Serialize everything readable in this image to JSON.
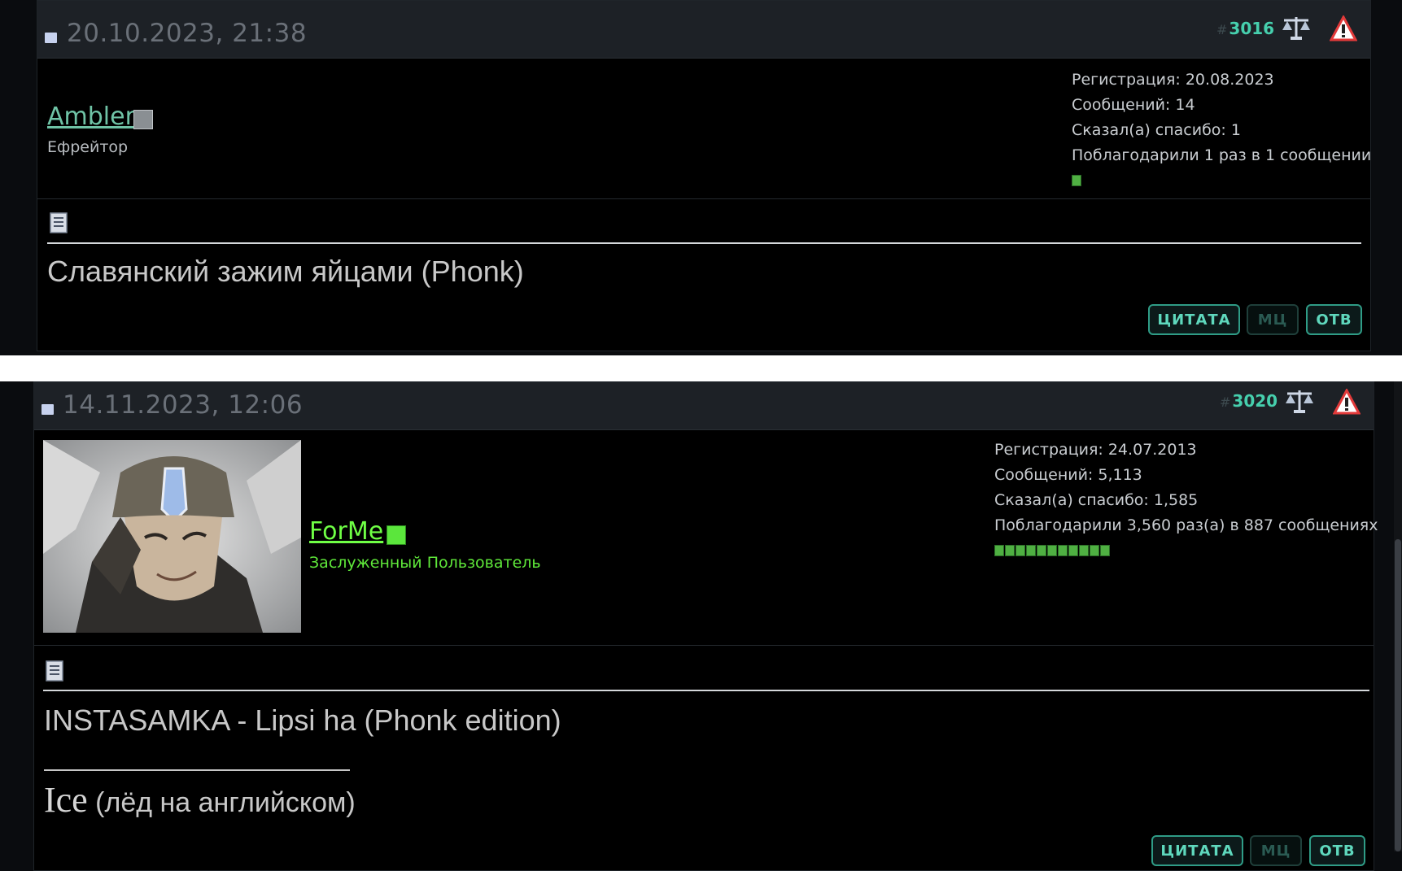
{
  "posts": [
    {
      "date": "20.10.2023, 21:38",
      "number_hash": "#",
      "number": "3016",
      "username": "Ambler",
      "user_title": "Ефрейтор",
      "stats": {
        "registration": "Регистрация: 20.08.2023",
        "messages": "Сообщений: 14",
        "said_thanks": "Сказал(а) спасибо: 1",
        "thanked": "Поблагодарили 1 раз в 1 сообщении"
      },
      "reputation_segments": 1,
      "body_line1": "Славянский зажим яйцами (Phonk)",
      "buttons": {
        "quote": "ЦИТАТА",
        "multiquote": "МЦ",
        "reply": "ОТВ"
      }
    },
    {
      "date": "14.11.2023, 12:06",
      "number_hash": "#",
      "number": "3020",
      "username": "ForMe",
      "user_title": "Заслуженный Пользователь",
      "stats": {
        "registration": "Регистрация: 24.07.2013",
        "messages": "Сообщений: 5,113",
        "said_thanks": "Сказал(а) спасибо: 1,585",
        "thanked": "Поблагодарили 3,560 раз(а) в 887 сообщениях"
      },
      "reputation_segments": 11,
      "body_line1": "INSTASAMKA - Lipsi ha (Phonk edition)",
      "signature_big": "Ice",
      "signature_small": " (лёд на английском)",
      "buttons": {
        "quote": "ЦИТАТА",
        "multiquote": "МЦ",
        "reply": "ОТВ"
      }
    }
  ],
  "icons": {
    "post_dot": "post-icon",
    "scale": "balance-scale-icon",
    "warning": "warning-icon",
    "document": "document-icon",
    "online": "online-status-icon",
    "avatar": "user-avatar"
  },
  "colors": {
    "accent_teal": "#46cfad",
    "username_1": "#6fc3a6",
    "username_2": "#6fff45",
    "title_2": "#5fe83a",
    "header_bg": "#1d2126"
  }
}
